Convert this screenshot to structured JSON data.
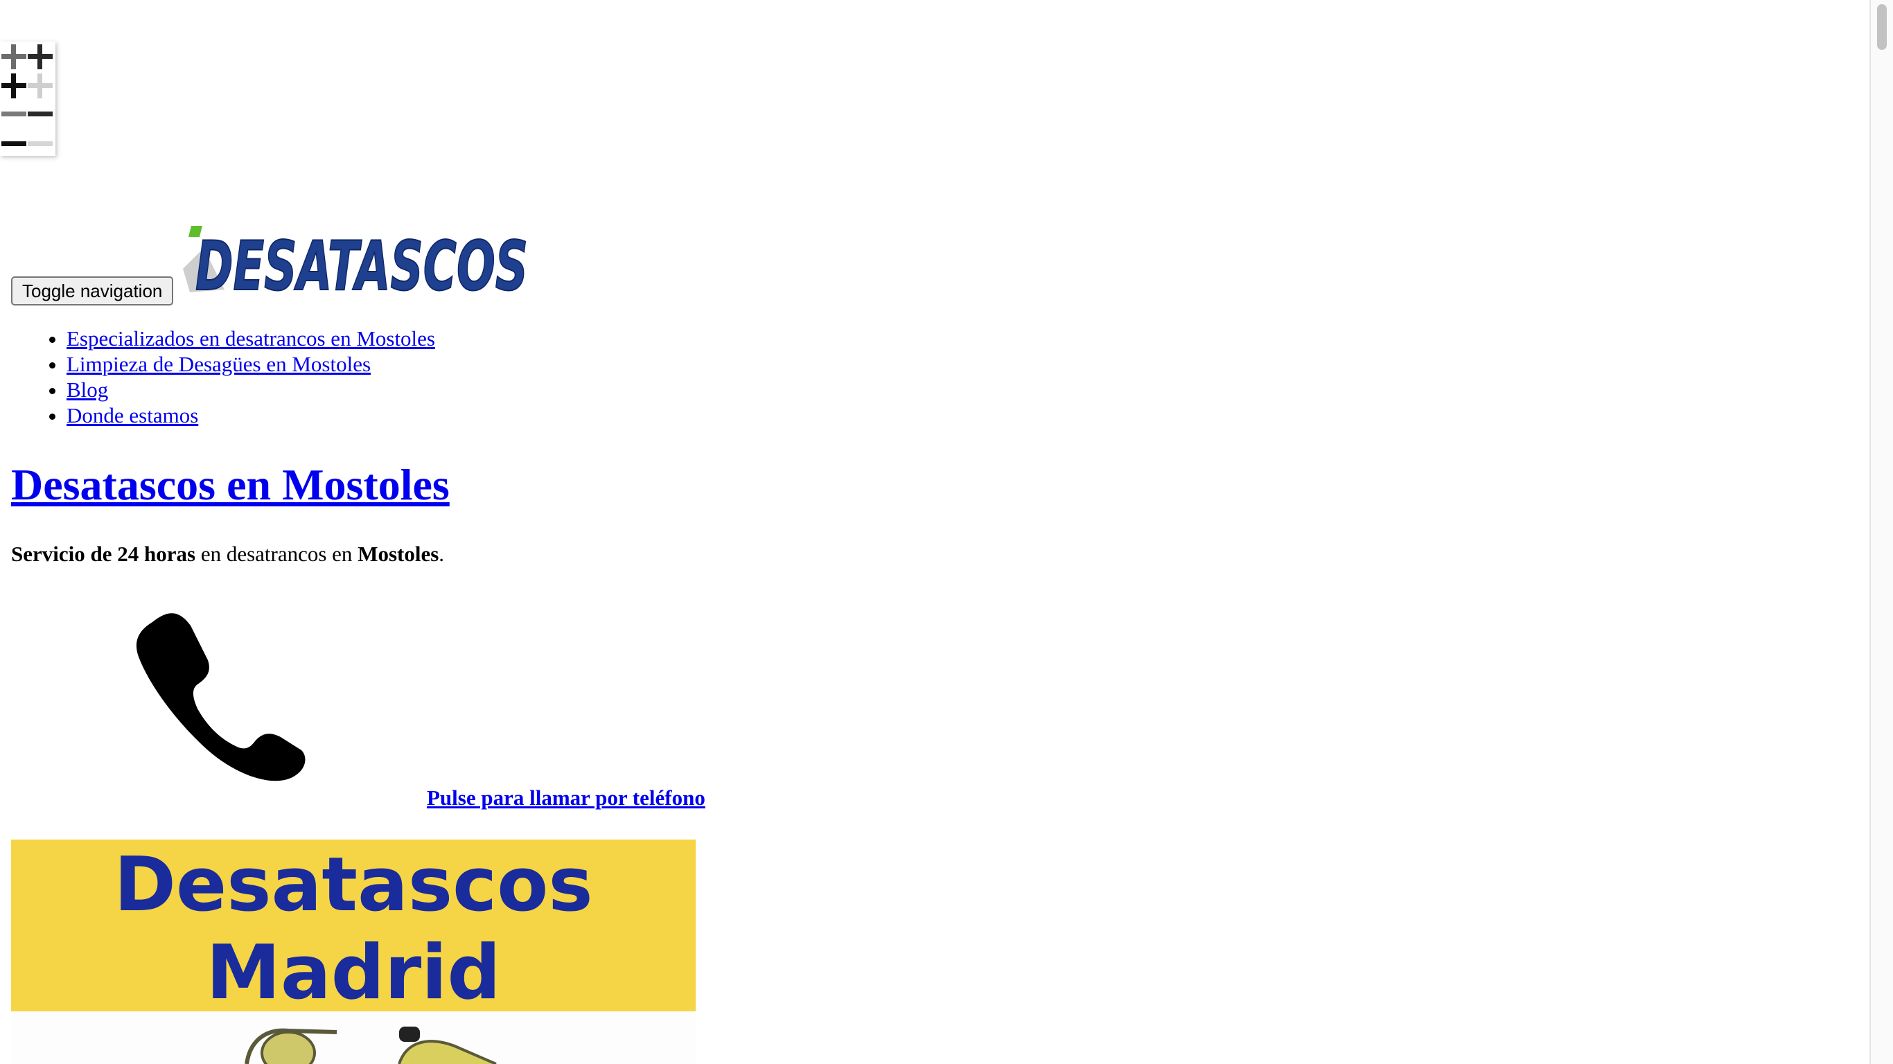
{
  "zoom_control": {
    "zoom_in_icon": "plus-icon",
    "zoom_out_icon": "minus-icon"
  },
  "header": {
    "toggle_label": "Toggle navigation",
    "logo_text": "DESATASCOS"
  },
  "nav": {
    "items": [
      {
        "label": "Especializados en desatrancos en Mostoles"
      },
      {
        "label": "Limpieza de Desagües en Mostoles"
      },
      {
        "label": "Blog"
      },
      {
        "label": "Donde estamos"
      }
    ]
  },
  "main": {
    "title": "Desatascos en Mostoles",
    "intro": {
      "strong1": "Servicio de 24 horas",
      "middle": " en desatrancos en ",
      "strong2": "Mostoles",
      "end": "."
    },
    "phone_icon": "phone-icon",
    "call_label": "Pulse para llamar por teléfono",
    "banner": {
      "line1": "Desatascos",
      "line2": "Madrid"
    }
  },
  "colors": {
    "link": "#0000ee",
    "banner_bg": "#f5d545",
    "banner_text": "#1a2b9c",
    "logo_blue": "#1f3f8f",
    "logo_green": "#5fbf2a"
  }
}
